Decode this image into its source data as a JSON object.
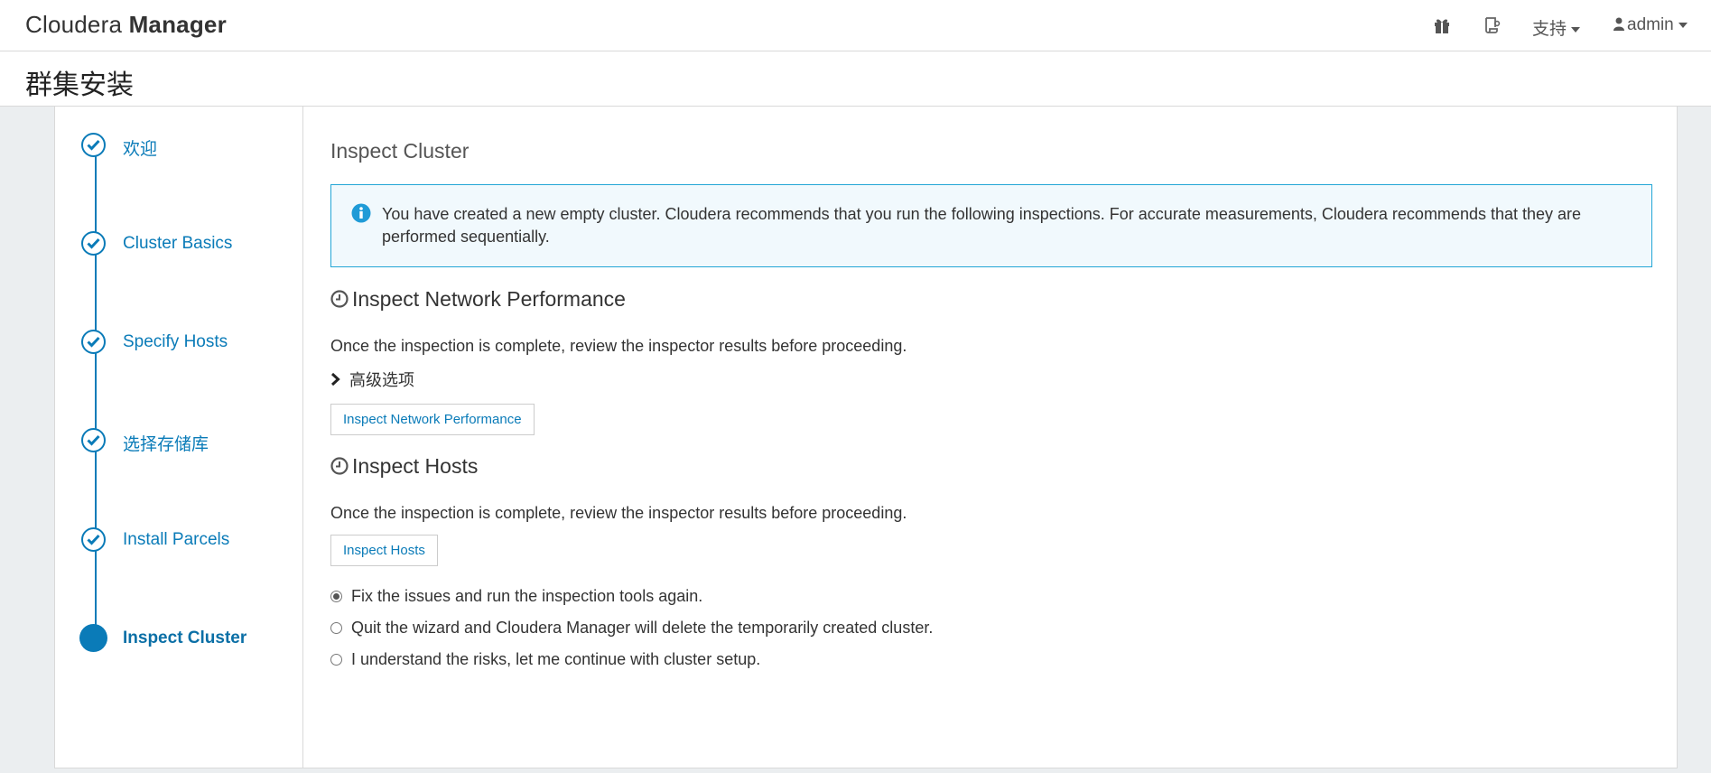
{
  "header": {
    "brand_light": "Cloudera",
    "brand_bold": "Manager",
    "gift_icon": "gift-icon",
    "running_commands_icon": "commands-icon",
    "support_label": "支持",
    "user_label": "admin"
  },
  "page": {
    "title": "群集安装"
  },
  "steps": [
    {
      "label": "欢迎",
      "state": "done"
    },
    {
      "label": "Cluster Basics",
      "state": "done"
    },
    {
      "label": "Specify Hosts",
      "state": "done"
    },
    {
      "label": "选择存储库",
      "state": "done"
    },
    {
      "label": "Install Parcels",
      "state": "done"
    },
    {
      "label": "Inspect Cluster",
      "state": "active"
    }
  ],
  "content": {
    "title": "Inspect Cluster",
    "alert_text": "You have created a new empty cluster. Cloudera recommends that you run the following inspections. For accurate measurements, Cloudera recommends that they are performed sequentially.",
    "network": {
      "heading": "Inspect Network Performance",
      "description": "Once the inspection is complete, review the inspector results before proceeding.",
      "advanced_label": "高级选项",
      "button_label": "Inspect Network Performance"
    },
    "hosts": {
      "heading": "Inspect Hosts",
      "description": "Once the inspection is complete, review the inspector results before proceeding.",
      "button_label": "Inspect Hosts"
    },
    "options": [
      {
        "label": "Fix the issues and run the inspection tools again.",
        "checked": true
      },
      {
        "label": "Quit the wizard and Cloudera Manager will delete the temporarily created cluster.",
        "checked": false
      },
      {
        "label": "I understand the risks, let me continue with cluster setup.",
        "checked": false
      }
    ]
  },
  "colors": {
    "accent": "#0a7bb8",
    "alert_border": "#23a6d6",
    "alert_bg": "#f1f9fd",
    "info_icon": "#1f9bd7"
  }
}
